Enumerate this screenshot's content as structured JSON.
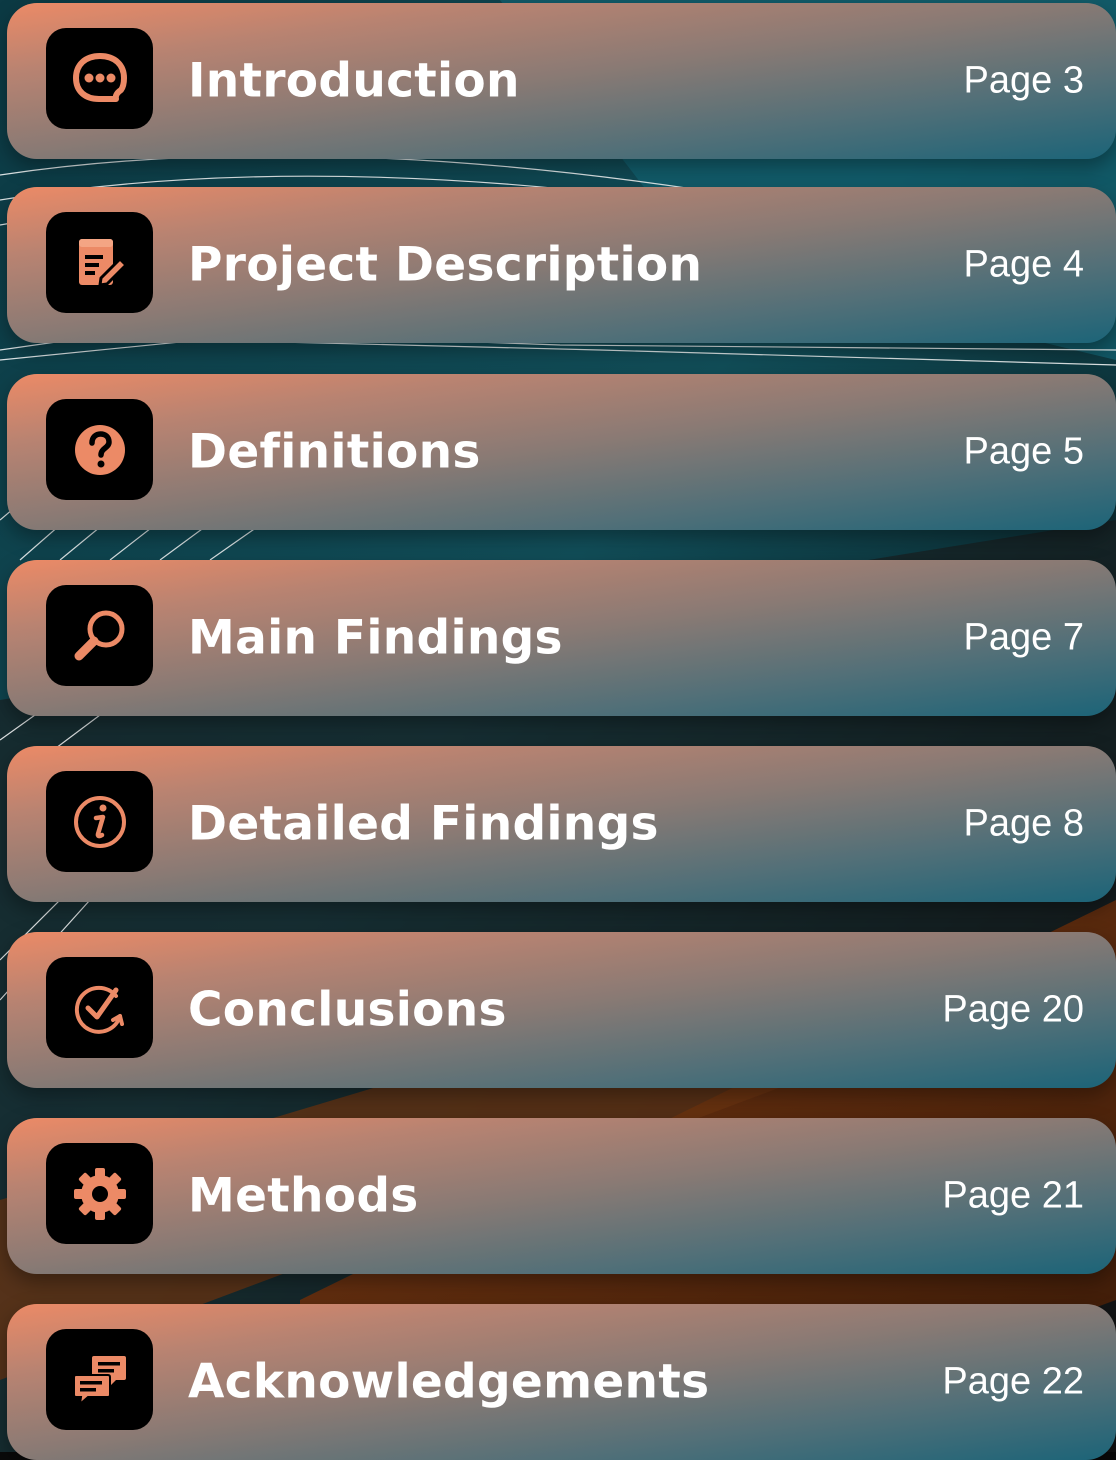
{
  "colors": {
    "accent": "#ec8a66",
    "teal": "#1c6478",
    "icon_bg": "#000000",
    "text": "#ffffff"
  },
  "toc": [
    {
      "title": "Introduction",
      "page": "Page 3",
      "icon": "chat-bubble-icon"
    },
    {
      "title": "Project Description",
      "page": "Page 4",
      "icon": "document-edit-icon"
    },
    {
      "title": "Definitions",
      "page": "Page 5",
      "icon": "question-icon"
    },
    {
      "title": "Main Findings",
      "page": "Page 7",
      "icon": "magnifier-icon"
    },
    {
      "title": "Detailed Findings",
      "page": "Page 8",
      "icon": "info-icon"
    },
    {
      "title": "Conclusions",
      "page": "Page 20",
      "icon": "check-cycle-icon"
    },
    {
      "title": "Methods",
      "page": "Page 21",
      "icon": "gear-icon"
    },
    {
      "title": "Acknowledgements",
      "page": "Page 22",
      "icon": "speech-bubbles-icon"
    }
  ]
}
